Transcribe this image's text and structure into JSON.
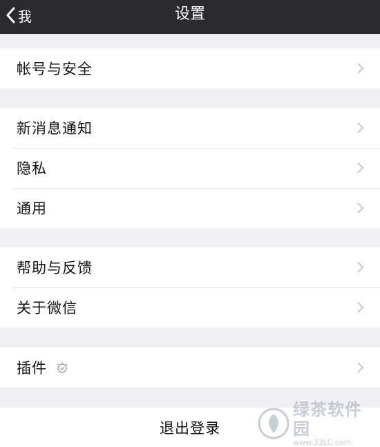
{
  "nav": {
    "back_label": "我",
    "title": "设置"
  },
  "groups": [
    {
      "items": [
        {
          "label": "帐号与安全"
        }
      ]
    },
    {
      "items": [
        {
          "label": "新消息通知"
        },
        {
          "label": "隐私"
        },
        {
          "label": "通用"
        }
      ]
    },
    {
      "items": [
        {
          "label": "帮助与反馈"
        },
        {
          "label": "关于微信"
        }
      ]
    },
    {
      "items": [
        {
          "label": "插件",
          "icon": "plugin-bulb-icon"
        }
      ]
    }
  ],
  "logout": {
    "label": "退出登录"
  },
  "watermark": {
    "name": "绿茶软件园",
    "url": "www.33LC.com"
  },
  "colors": {
    "navbar": "#2b2a2f",
    "background": "#efeff4",
    "chevron": "#c7c7cc"
  }
}
